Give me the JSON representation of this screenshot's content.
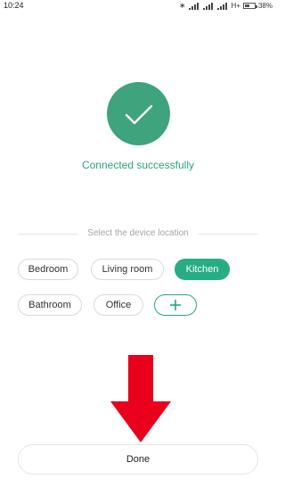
{
  "status_bar": {
    "time": "10:24",
    "network_label": "H+",
    "battery": "38%"
  },
  "confirmation": {
    "message": "Connected successfully",
    "accent_color": "#3fa37d"
  },
  "location_section": {
    "label": "Select the device location",
    "options": [
      "Bedroom",
      "Living room",
      "Kitchen",
      "Bathroom",
      "Office"
    ],
    "selected": "Kitchen",
    "add_icon": "plus-icon"
  },
  "overlay": {
    "icon": "arrow-down-icon",
    "color": "#e8001c"
  },
  "footer": {
    "done_label": "Done"
  }
}
